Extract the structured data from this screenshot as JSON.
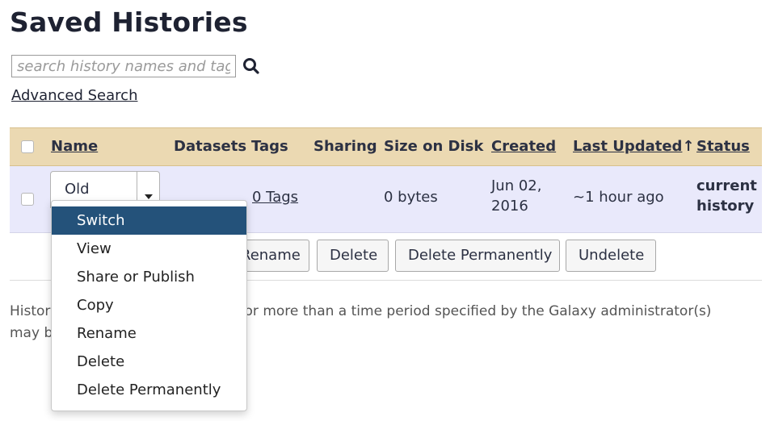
{
  "page": {
    "title": "Saved Histories"
  },
  "search": {
    "placeholder": "search history names and tags",
    "value": "",
    "advanced_label": "Advanced Search",
    "icon": "search-icon"
  },
  "table": {
    "columns": {
      "name": "Name",
      "datasets": "Datasets",
      "tags": "Tags",
      "sharing": "Sharing",
      "size": "Size on Disk",
      "created": "Created",
      "updated": "Last Updated",
      "updated_sort": "↑",
      "status": "Status"
    },
    "rows": [
      {
        "name": "Old",
        "datasets": "",
        "tags": "0 Tags",
        "sharing": "",
        "size": "0 bytes",
        "created_line1": "Jun 02,",
        "created_line2": "2016",
        "updated": "~1 hour ago",
        "status_line1": "current",
        "status_line2": "history"
      }
    ]
  },
  "operations": [
    "Rename",
    "Delete",
    "Delete Permanently",
    "Undelete"
  ],
  "note": "Histories that have been deleted for more than a time period specified by the Galaxy administrator(s) may be permanently deleted.",
  "menu": {
    "items": [
      "Switch",
      "View",
      "Share or Publish",
      "Copy",
      "Rename",
      "Delete",
      "Delete Permanently"
    ],
    "active": "Switch"
  },
  "colors": {
    "header_bg": "#ebd9b2",
    "row_bg": "#e9e9fb",
    "menu_active": "#24527a"
  }
}
